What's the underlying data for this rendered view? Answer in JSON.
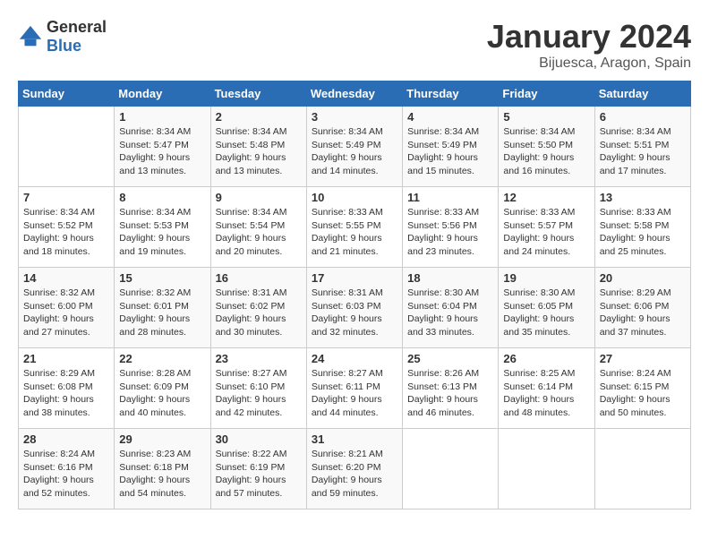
{
  "logo": {
    "general": "General",
    "blue": "Blue"
  },
  "title": "January 2024",
  "subtitle": "Bijuesca, Aragon, Spain",
  "days_of_week": [
    "Sunday",
    "Monday",
    "Tuesday",
    "Wednesday",
    "Thursday",
    "Friday",
    "Saturday"
  ],
  "weeks": [
    [
      {
        "day": "",
        "info": ""
      },
      {
        "day": "1",
        "info": "Sunrise: 8:34 AM\nSunset: 5:47 PM\nDaylight: 9 hours\nand 13 minutes."
      },
      {
        "day": "2",
        "info": "Sunrise: 8:34 AM\nSunset: 5:48 PM\nDaylight: 9 hours\nand 13 minutes."
      },
      {
        "day": "3",
        "info": "Sunrise: 8:34 AM\nSunset: 5:49 PM\nDaylight: 9 hours\nand 14 minutes."
      },
      {
        "day": "4",
        "info": "Sunrise: 8:34 AM\nSunset: 5:49 PM\nDaylight: 9 hours\nand 15 minutes."
      },
      {
        "day": "5",
        "info": "Sunrise: 8:34 AM\nSunset: 5:50 PM\nDaylight: 9 hours\nand 16 minutes."
      },
      {
        "day": "6",
        "info": "Sunrise: 8:34 AM\nSunset: 5:51 PM\nDaylight: 9 hours\nand 17 minutes."
      }
    ],
    [
      {
        "day": "7",
        "info": "Sunrise: 8:34 AM\nSunset: 5:52 PM\nDaylight: 9 hours\nand 18 minutes."
      },
      {
        "day": "8",
        "info": "Sunrise: 8:34 AM\nSunset: 5:53 PM\nDaylight: 9 hours\nand 19 minutes."
      },
      {
        "day": "9",
        "info": "Sunrise: 8:34 AM\nSunset: 5:54 PM\nDaylight: 9 hours\nand 20 minutes."
      },
      {
        "day": "10",
        "info": "Sunrise: 8:33 AM\nSunset: 5:55 PM\nDaylight: 9 hours\nand 21 minutes."
      },
      {
        "day": "11",
        "info": "Sunrise: 8:33 AM\nSunset: 5:56 PM\nDaylight: 9 hours\nand 23 minutes."
      },
      {
        "day": "12",
        "info": "Sunrise: 8:33 AM\nSunset: 5:57 PM\nDaylight: 9 hours\nand 24 minutes."
      },
      {
        "day": "13",
        "info": "Sunrise: 8:33 AM\nSunset: 5:58 PM\nDaylight: 9 hours\nand 25 minutes."
      }
    ],
    [
      {
        "day": "14",
        "info": "Sunrise: 8:32 AM\nSunset: 6:00 PM\nDaylight: 9 hours\nand 27 minutes."
      },
      {
        "day": "15",
        "info": "Sunrise: 8:32 AM\nSunset: 6:01 PM\nDaylight: 9 hours\nand 28 minutes."
      },
      {
        "day": "16",
        "info": "Sunrise: 8:31 AM\nSunset: 6:02 PM\nDaylight: 9 hours\nand 30 minutes."
      },
      {
        "day": "17",
        "info": "Sunrise: 8:31 AM\nSunset: 6:03 PM\nDaylight: 9 hours\nand 32 minutes."
      },
      {
        "day": "18",
        "info": "Sunrise: 8:30 AM\nSunset: 6:04 PM\nDaylight: 9 hours\nand 33 minutes."
      },
      {
        "day": "19",
        "info": "Sunrise: 8:30 AM\nSunset: 6:05 PM\nDaylight: 9 hours\nand 35 minutes."
      },
      {
        "day": "20",
        "info": "Sunrise: 8:29 AM\nSunset: 6:06 PM\nDaylight: 9 hours\nand 37 minutes."
      }
    ],
    [
      {
        "day": "21",
        "info": "Sunrise: 8:29 AM\nSunset: 6:08 PM\nDaylight: 9 hours\nand 38 minutes."
      },
      {
        "day": "22",
        "info": "Sunrise: 8:28 AM\nSunset: 6:09 PM\nDaylight: 9 hours\nand 40 minutes."
      },
      {
        "day": "23",
        "info": "Sunrise: 8:27 AM\nSunset: 6:10 PM\nDaylight: 9 hours\nand 42 minutes."
      },
      {
        "day": "24",
        "info": "Sunrise: 8:27 AM\nSunset: 6:11 PM\nDaylight: 9 hours\nand 44 minutes."
      },
      {
        "day": "25",
        "info": "Sunrise: 8:26 AM\nSunset: 6:13 PM\nDaylight: 9 hours\nand 46 minutes."
      },
      {
        "day": "26",
        "info": "Sunrise: 8:25 AM\nSunset: 6:14 PM\nDaylight: 9 hours\nand 48 minutes."
      },
      {
        "day": "27",
        "info": "Sunrise: 8:24 AM\nSunset: 6:15 PM\nDaylight: 9 hours\nand 50 minutes."
      }
    ],
    [
      {
        "day": "28",
        "info": "Sunrise: 8:24 AM\nSunset: 6:16 PM\nDaylight: 9 hours\nand 52 minutes."
      },
      {
        "day": "29",
        "info": "Sunrise: 8:23 AM\nSunset: 6:18 PM\nDaylight: 9 hours\nand 54 minutes."
      },
      {
        "day": "30",
        "info": "Sunrise: 8:22 AM\nSunset: 6:19 PM\nDaylight: 9 hours\nand 57 minutes."
      },
      {
        "day": "31",
        "info": "Sunrise: 8:21 AM\nSunset: 6:20 PM\nDaylight: 9 hours\nand 59 minutes."
      },
      {
        "day": "",
        "info": ""
      },
      {
        "day": "",
        "info": ""
      },
      {
        "day": "",
        "info": ""
      }
    ]
  ]
}
